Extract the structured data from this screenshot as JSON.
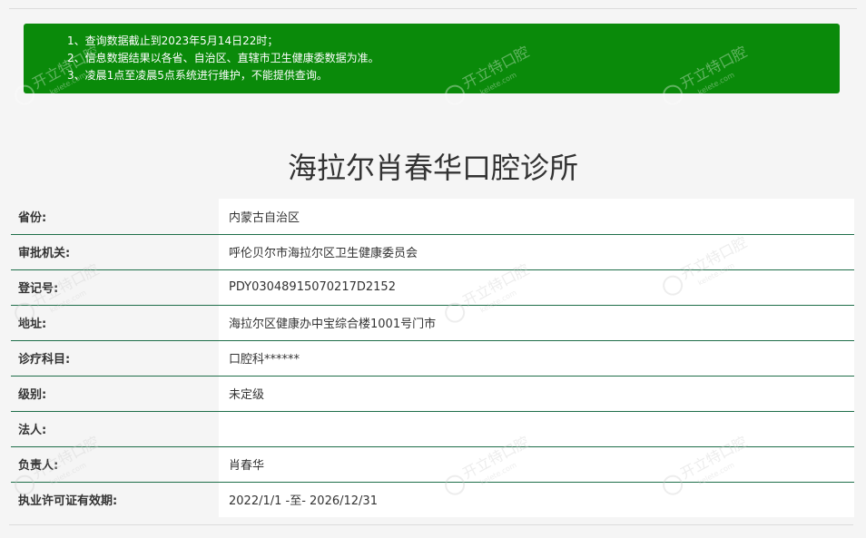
{
  "notice": {
    "lines": [
      "1、查询数据截止到2023年5月14日22时；",
      "2、信息数据结果以各省、自治区、直辖市卫生健康委数据为准。",
      "3、凌晨1点至凌晨5点系统进行维护，不能提供查询。"
    ]
  },
  "title": "海拉尔肖春华口腔诊所",
  "rows": [
    {
      "label": "省份:",
      "value": "内蒙古自治区"
    },
    {
      "label": "审批机关:",
      "value": "呼伦贝尔市海拉尔区卫生健康委员会"
    },
    {
      "label": "登记号:",
      "value": "PDY03048915070217D2152"
    },
    {
      "label": "地址:",
      "value": "海拉尔区健康办中宝综合楼1001号门市"
    },
    {
      "label": "诊疗科目:",
      "value": "口腔科******"
    },
    {
      "label": "级别:",
      "value": "未定级"
    },
    {
      "label": "法人:",
      "value": ""
    },
    {
      "label": "负责人:",
      "value": "肖春华"
    },
    {
      "label": "执业许可证有效期:",
      "value": "2022/1/1 -至- 2026/12/31"
    }
  ],
  "watermark": {
    "text": "开立特口腔",
    "subtext": "kelete.com"
  },
  "colors": {
    "notice_bg": "#0a8a0a",
    "row_border": "#1e6e49"
  }
}
